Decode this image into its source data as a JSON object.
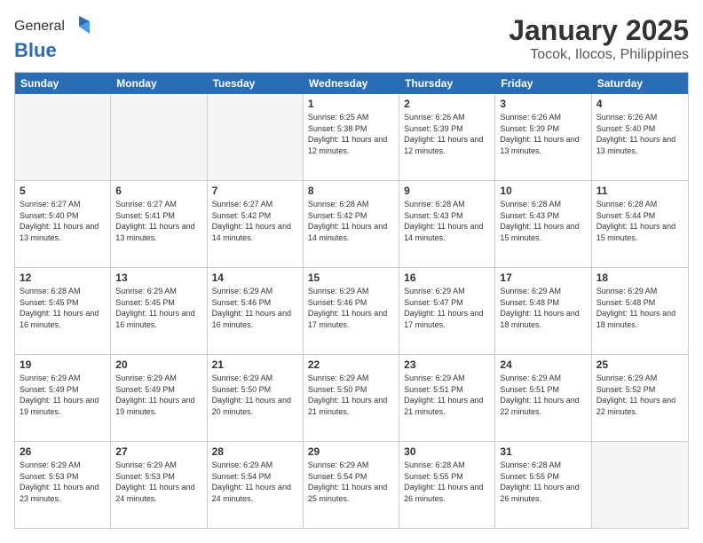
{
  "logo": {
    "general": "General",
    "blue": "Blue"
  },
  "title": "January 2025",
  "subtitle": "Tocok, Ilocos, Philippines",
  "header_days": [
    "Sunday",
    "Monday",
    "Tuesday",
    "Wednesday",
    "Thursday",
    "Friday",
    "Saturday"
  ],
  "weeks": [
    [
      {
        "day": "",
        "sunrise": "",
        "sunset": "",
        "daylight": "",
        "empty": true
      },
      {
        "day": "",
        "sunrise": "",
        "sunset": "",
        "daylight": "",
        "empty": true
      },
      {
        "day": "",
        "sunrise": "",
        "sunset": "",
        "daylight": "",
        "empty": true
      },
      {
        "day": "1",
        "sunrise": "Sunrise: 6:25 AM",
        "sunset": "Sunset: 5:38 PM",
        "daylight": "Daylight: 11 hours and 12 minutes."
      },
      {
        "day": "2",
        "sunrise": "Sunrise: 6:26 AM",
        "sunset": "Sunset: 5:39 PM",
        "daylight": "Daylight: 11 hours and 12 minutes."
      },
      {
        "day": "3",
        "sunrise": "Sunrise: 6:26 AM",
        "sunset": "Sunset: 5:39 PM",
        "daylight": "Daylight: 11 hours and 13 minutes."
      },
      {
        "day": "4",
        "sunrise": "Sunrise: 6:26 AM",
        "sunset": "Sunset: 5:40 PM",
        "daylight": "Daylight: 11 hours and 13 minutes."
      }
    ],
    [
      {
        "day": "5",
        "sunrise": "Sunrise: 6:27 AM",
        "sunset": "Sunset: 5:40 PM",
        "daylight": "Daylight: 11 hours and 13 minutes."
      },
      {
        "day": "6",
        "sunrise": "Sunrise: 6:27 AM",
        "sunset": "Sunset: 5:41 PM",
        "daylight": "Daylight: 11 hours and 13 minutes."
      },
      {
        "day": "7",
        "sunrise": "Sunrise: 6:27 AM",
        "sunset": "Sunset: 5:42 PM",
        "daylight": "Daylight: 11 hours and 14 minutes."
      },
      {
        "day": "8",
        "sunrise": "Sunrise: 6:28 AM",
        "sunset": "Sunset: 5:42 PM",
        "daylight": "Daylight: 11 hours and 14 minutes."
      },
      {
        "day": "9",
        "sunrise": "Sunrise: 6:28 AM",
        "sunset": "Sunset: 5:43 PM",
        "daylight": "Daylight: 11 hours and 14 minutes."
      },
      {
        "day": "10",
        "sunrise": "Sunrise: 6:28 AM",
        "sunset": "Sunset: 5:43 PM",
        "daylight": "Daylight: 11 hours and 15 minutes."
      },
      {
        "day": "11",
        "sunrise": "Sunrise: 6:28 AM",
        "sunset": "Sunset: 5:44 PM",
        "daylight": "Daylight: 11 hours and 15 minutes."
      }
    ],
    [
      {
        "day": "12",
        "sunrise": "Sunrise: 6:28 AM",
        "sunset": "Sunset: 5:45 PM",
        "daylight": "Daylight: 11 hours and 16 minutes."
      },
      {
        "day": "13",
        "sunrise": "Sunrise: 6:29 AM",
        "sunset": "Sunset: 5:45 PM",
        "daylight": "Daylight: 11 hours and 16 minutes."
      },
      {
        "day": "14",
        "sunrise": "Sunrise: 6:29 AM",
        "sunset": "Sunset: 5:46 PM",
        "daylight": "Daylight: 11 hours and 16 minutes."
      },
      {
        "day": "15",
        "sunrise": "Sunrise: 6:29 AM",
        "sunset": "Sunset: 5:46 PM",
        "daylight": "Daylight: 11 hours and 17 minutes."
      },
      {
        "day": "16",
        "sunrise": "Sunrise: 6:29 AM",
        "sunset": "Sunset: 5:47 PM",
        "daylight": "Daylight: 11 hours and 17 minutes."
      },
      {
        "day": "17",
        "sunrise": "Sunrise: 6:29 AM",
        "sunset": "Sunset: 5:48 PM",
        "daylight": "Daylight: 11 hours and 18 minutes."
      },
      {
        "day": "18",
        "sunrise": "Sunrise: 6:29 AM",
        "sunset": "Sunset: 5:48 PM",
        "daylight": "Daylight: 11 hours and 18 minutes."
      }
    ],
    [
      {
        "day": "19",
        "sunrise": "Sunrise: 6:29 AM",
        "sunset": "Sunset: 5:49 PM",
        "daylight": "Daylight: 11 hours and 19 minutes."
      },
      {
        "day": "20",
        "sunrise": "Sunrise: 6:29 AM",
        "sunset": "Sunset: 5:49 PM",
        "daylight": "Daylight: 11 hours and 19 minutes."
      },
      {
        "day": "21",
        "sunrise": "Sunrise: 6:29 AM",
        "sunset": "Sunset: 5:50 PM",
        "daylight": "Daylight: 11 hours and 20 minutes."
      },
      {
        "day": "22",
        "sunrise": "Sunrise: 6:29 AM",
        "sunset": "Sunset: 5:50 PM",
        "daylight": "Daylight: 11 hours and 21 minutes."
      },
      {
        "day": "23",
        "sunrise": "Sunrise: 6:29 AM",
        "sunset": "Sunset: 5:51 PM",
        "daylight": "Daylight: 11 hours and 21 minutes."
      },
      {
        "day": "24",
        "sunrise": "Sunrise: 6:29 AM",
        "sunset": "Sunset: 5:51 PM",
        "daylight": "Daylight: 11 hours and 22 minutes."
      },
      {
        "day": "25",
        "sunrise": "Sunrise: 6:29 AM",
        "sunset": "Sunset: 5:52 PM",
        "daylight": "Daylight: 11 hours and 22 minutes."
      }
    ],
    [
      {
        "day": "26",
        "sunrise": "Sunrise: 6:29 AM",
        "sunset": "Sunset: 5:53 PM",
        "daylight": "Daylight: 11 hours and 23 minutes."
      },
      {
        "day": "27",
        "sunrise": "Sunrise: 6:29 AM",
        "sunset": "Sunset: 5:53 PM",
        "daylight": "Daylight: 11 hours and 24 minutes."
      },
      {
        "day": "28",
        "sunrise": "Sunrise: 6:29 AM",
        "sunset": "Sunset: 5:54 PM",
        "daylight": "Daylight: 11 hours and 24 minutes."
      },
      {
        "day": "29",
        "sunrise": "Sunrise: 6:29 AM",
        "sunset": "Sunset: 5:54 PM",
        "daylight": "Daylight: 11 hours and 25 minutes."
      },
      {
        "day": "30",
        "sunrise": "Sunrise: 6:28 AM",
        "sunset": "Sunset: 5:55 PM",
        "daylight": "Daylight: 11 hours and 26 minutes."
      },
      {
        "day": "31",
        "sunrise": "Sunrise: 6:28 AM",
        "sunset": "Sunset: 5:55 PM",
        "daylight": "Daylight: 11 hours and 26 minutes."
      },
      {
        "day": "",
        "sunrise": "",
        "sunset": "",
        "daylight": "",
        "empty": true
      }
    ]
  ]
}
